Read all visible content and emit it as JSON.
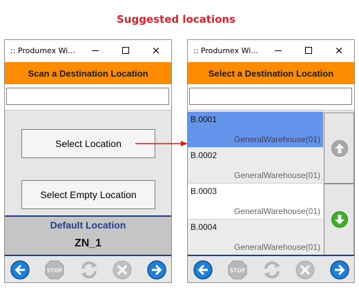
{
  "caption": "Suggested locations",
  "colors": {
    "caption": "#e0202a",
    "header": "#ff8c00",
    "selected_row": "#6495ed",
    "accent_blue": "#223c8a",
    "nav_blue": "#1e7fd6"
  },
  "left_window": {
    "title": ":: Produmex Wi...",
    "header": "Scan a Destination Location",
    "input_value": "",
    "select_location_label": "Select Location",
    "select_empty_label": "Select Empty Location",
    "default_label": "Default Location",
    "default_value": "ZN_1"
  },
  "right_window": {
    "title": ":: Produmex Wi...",
    "header": "Select a Destination Location",
    "input_value": "",
    "locations": [
      {
        "code": "B.0001",
        "warehouse": "GeneralWarehouse(01)",
        "selected": true
      },
      {
        "code": "B.0002",
        "warehouse": "GeneralWarehouse(01)",
        "selected": false
      },
      {
        "code": "B.0003",
        "warehouse": "GeneralWarehouse(01)",
        "selected": false
      },
      {
        "code": "B.0004",
        "warehouse": "GeneralWarehouse(01)",
        "selected": false
      }
    ],
    "side_icons": [
      "scroll-up-icon",
      "scroll-down-icon"
    ]
  },
  "window_controls": {
    "minimize": "minimize-icon",
    "maximize": "maximize-icon",
    "close": "×"
  },
  "toolbar_icons": [
    "back-arrow-icon",
    "stop-icon",
    "refresh-icon",
    "cancel-icon",
    "forward-arrow-icon"
  ],
  "stop_text": "STOP"
}
